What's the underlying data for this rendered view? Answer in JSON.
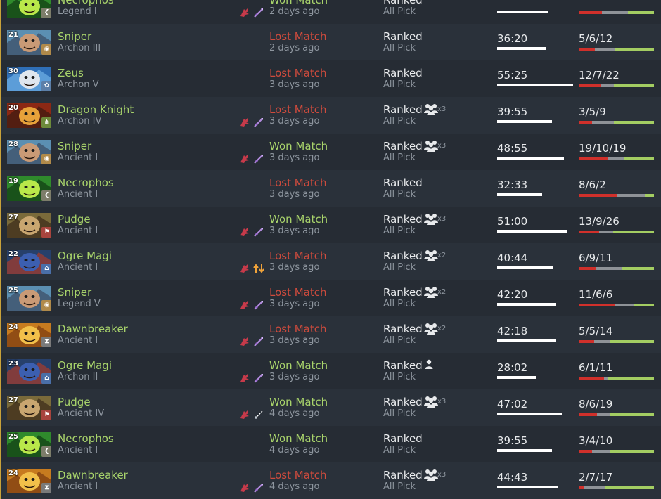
{
  "heroes": {
    "Sniper": {
      "bg": "#5b8fb2",
      "fg": "#c99a76",
      "accent": "#3a4a62"
    },
    "Zeus": {
      "bg": "#2f6fb7",
      "fg": "#dfe6ee",
      "accent": "#6fb0e6"
    },
    "Dragon Knight": {
      "bg": "#8c2814",
      "fg": "#e8a23a",
      "accent": "#3a1a10"
    },
    "Necrophos": {
      "bg": "#2f8a2c",
      "fg": "#b9e84a",
      "accent": "#0f3a12"
    },
    "Pudge": {
      "bg": "#7a6a3a",
      "fg": "#c9a670",
      "accent": "#3a2a18"
    },
    "Ogre Magi": {
      "bg": "#27406b",
      "fg": "#3c5fb0",
      "accent": "#a83a2a"
    },
    "Dawnbreaker": {
      "bg": "#c77b1f",
      "fg": "#f2c04a",
      "accent": "#7a3a10"
    }
  },
  "roles": {
    "carry": {
      "color": "#7d7d6a",
      "glyph": "❮"
    },
    "mid": {
      "color": "#b08a4a",
      "glyph": "◉"
    },
    "support": {
      "color": "#5c7fa8",
      "glyph": "✿"
    },
    "offlane": {
      "color": "#6d8a3a",
      "glyph": "⋔"
    },
    "roamer": {
      "color": "#a8443d",
      "glyph": "⚑"
    },
    "hard": {
      "color": "#4a6fa8",
      "glyph": "⌂"
    },
    "timer": {
      "color": "#7a7a7a",
      "glyph": "⧗"
    }
  },
  "colors": {
    "won": "#a8d36b",
    "lost": "#ce4b3d",
    "kills": "#d0302b",
    "deaths": "#8e9297",
    "assists": "#a3cd62",
    "hero_name": "#a8d36b"
  },
  "matches": [
    {
      "level": "",
      "hero": "Necrophos",
      "rank": "Legend I",
      "role": "carry",
      "items": [
        "claw",
        "lance"
      ],
      "result": "Won Match",
      "outcome": "won",
      "time": "2 days ago",
      "type": "Ranked",
      "party": 0,
      "mode": "All Pick",
      "duration": "",
      "duration_ratio": 0.68,
      "kda": "",
      "kda_counts": [
        7,
        8,
        8
      ]
    },
    {
      "level": "21",
      "hero": "Sniper",
      "rank": "Archon III",
      "role": "mid",
      "items": [],
      "result": "Lost Match",
      "outcome": "lost",
      "time": "2 days ago",
      "type": "Ranked",
      "party": 0,
      "mode": "All Pick",
      "duration": "36:20",
      "duration_ratio": 0.65,
      "kda": "5/6/12",
      "kda_counts": [
        5,
        6,
        12
      ]
    },
    {
      "level": "30",
      "hero": "Zeus",
      "rank": "Archon V",
      "role": "support",
      "items": [],
      "result": "Lost Match",
      "outcome": "lost",
      "time": "3 days ago",
      "type": "Ranked",
      "party": 0,
      "mode": "All Pick",
      "duration": "55:25",
      "duration_ratio": 1.0,
      "kda": "12/7/22",
      "kda_counts": [
        12,
        7,
        22
      ]
    },
    {
      "level": "20",
      "hero": "Dragon Knight",
      "rank": "Archon IV",
      "role": "offlane",
      "items": [
        "claw",
        "lance"
      ],
      "result": "Lost Match",
      "outcome": "lost",
      "time": "3 days ago",
      "type": "Ranked",
      "party": 3,
      "mode": "All Pick",
      "duration": "39:55",
      "duration_ratio": 0.72,
      "kda": "3/5/9",
      "kda_counts": [
        3,
        5,
        9
      ]
    },
    {
      "level": "28",
      "hero": "Sniper",
      "rank": "Ancient I",
      "role": "mid",
      "items": [
        "claw",
        "lance"
      ],
      "result": "Won Match",
      "outcome": "won",
      "time": "3 days ago",
      "type": "Ranked",
      "party": 3,
      "mode": "All Pick",
      "duration": "48:55",
      "duration_ratio": 0.88,
      "kda": "19/10/19",
      "kda_counts": [
        19,
        10,
        19
      ]
    },
    {
      "level": "19",
      "hero": "Necrophos",
      "rank": "Ancient I",
      "role": "carry",
      "items": [],
      "result": "Lost Match",
      "outcome": "lost",
      "time": "3 days ago",
      "type": "Ranked",
      "party": 0,
      "mode": "All Pick",
      "duration": "32:33",
      "duration_ratio": 0.59,
      "kda": "8/6/2",
      "kda_counts": [
        8,
        6,
        2
      ]
    },
    {
      "level": "27",
      "hero": "Pudge",
      "rank": "Ancient I",
      "role": "roamer",
      "items": [
        "claw",
        "lance"
      ],
      "result": "Won Match",
      "outcome": "won",
      "time": "3 days ago",
      "type": "Ranked",
      "party": 3,
      "mode": "All Pick",
      "duration": "51:00",
      "duration_ratio": 0.92,
      "kda": "13/9/26",
      "kda_counts": [
        13,
        9,
        26
      ]
    },
    {
      "level": "22",
      "hero": "Ogre Magi",
      "rank": "Ancient I",
      "role": "hard",
      "items": [
        "claw",
        "arrows"
      ],
      "result": "Lost Match",
      "outcome": "lost",
      "time": "3 days ago",
      "type": "Ranked",
      "party": 2,
      "mode": "All Pick",
      "duration": "40:44",
      "duration_ratio": 0.74,
      "kda": "6/9/11",
      "kda_counts": [
        6,
        9,
        11
      ]
    },
    {
      "level": "25",
      "hero": "Sniper",
      "rank": "Legend V",
      "role": "mid",
      "items": [
        "claw",
        "lance"
      ],
      "result": "Lost Match",
      "outcome": "lost",
      "time": "3 days ago",
      "type": "Ranked",
      "party": 2,
      "mode": "All Pick",
      "duration": "42:20",
      "duration_ratio": 0.77,
      "kda": "11/6/6",
      "kda_counts": [
        11,
        6,
        6
      ]
    },
    {
      "level": "24",
      "hero": "Dawnbreaker",
      "rank": "Ancient I",
      "role": "timer",
      "items": [
        "claw",
        "lance"
      ],
      "result": "Lost Match",
      "outcome": "lost",
      "time": "3 days ago",
      "type": "Ranked",
      "party": 2,
      "mode": "All Pick",
      "duration": "42:18",
      "duration_ratio": 0.77,
      "kda": "5/5/14",
      "kda_counts": [
        5,
        5,
        14
      ]
    },
    {
      "level": "23",
      "hero": "Ogre Magi",
      "rank": "Archon II",
      "role": "hard",
      "items": [
        "claw",
        "lance"
      ],
      "result": "Won Match",
      "outcome": "won",
      "time": "3 days ago",
      "type": "Ranked",
      "party": 1,
      "mode": "All Pick",
      "duration": "28:02",
      "duration_ratio": 0.51,
      "kda": "6/1/11",
      "kda_counts": [
        6,
        1,
        11
      ]
    },
    {
      "level": "27",
      "hero": "Pudge",
      "rank": "Ancient IV",
      "role": "roamer",
      "items": [
        "claw",
        "dash"
      ],
      "result": "Won Match",
      "outcome": "won",
      "time": "4 days ago",
      "type": "Ranked",
      "party": 3,
      "mode": "All Pick",
      "duration": "47:02",
      "duration_ratio": 0.85,
      "kda": "8/6/19",
      "kda_counts": [
        8,
        6,
        19
      ]
    },
    {
      "level": "25",
      "hero": "Necrophos",
      "rank": "Ancient I",
      "role": "carry",
      "items": [],
      "result": "Won Match",
      "outcome": "won",
      "time": "4 days ago",
      "type": "Ranked",
      "party": 0,
      "mode": "All Pick",
      "duration": "39:55",
      "duration_ratio": 0.72,
      "kda": "3/4/10",
      "kda_counts": [
        3,
        4,
        10
      ]
    },
    {
      "level": "24",
      "hero": "Dawnbreaker",
      "rank": "Ancient I",
      "role": "timer",
      "items": [
        "claw",
        "lance"
      ],
      "result": "Lost Match",
      "outcome": "lost",
      "time": "4 days ago",
      "type": "Ranked",
      "party": 3,
      "mode": "All Pick",
      "duration": "44:43",
      "duration_ratio": 0.81,
      "kda": "2/7/17",
      "kda_counts": [
        2,
        7,
        17
      ]
    }
  ]
}
